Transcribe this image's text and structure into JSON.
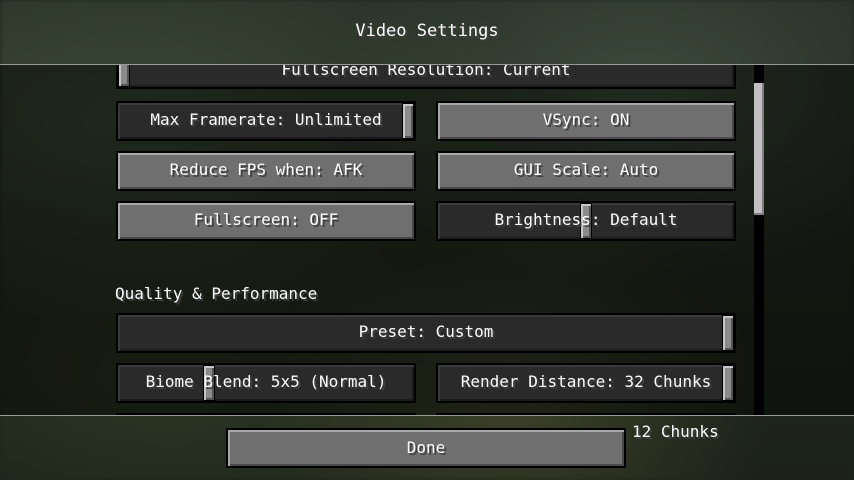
{
  "title": "Video Settings",
  "options": {
    "fullscreen_resolution": "Fullscreen Resolution: Current",
    "max_framerate": "Max Framerate: Unlimited",
    "vsync": "VSync: ON",
    "reduce_fps": "Reduce FPS when: AFK",
    "gui_scale": "GUI Scale: Auto",
    "fullscreen": "Fullscreen: OFF",
    "brightness": "Brightness: Default"
  },
  "section_quality": "Quality & Performance",
  "quality": {
    "preset": "Preset: Custom",
    "biome_blend": "Biome Blend: 5x5 (Normal)",
    "render_distance": "Render Distance: 32 Chunks",
    "partially_hidden_value": "12 Chunks"
  },
  "done_label": "Done",
  "slider_levels": {
    "fullscreen_resolution": 0.0,
    "max_framerate": 1.0,
    "brightness": 0.5,
    "preset": 1.0,
    "biome_blend": 0.3,
    "render_distance": 1.0
  }
}
